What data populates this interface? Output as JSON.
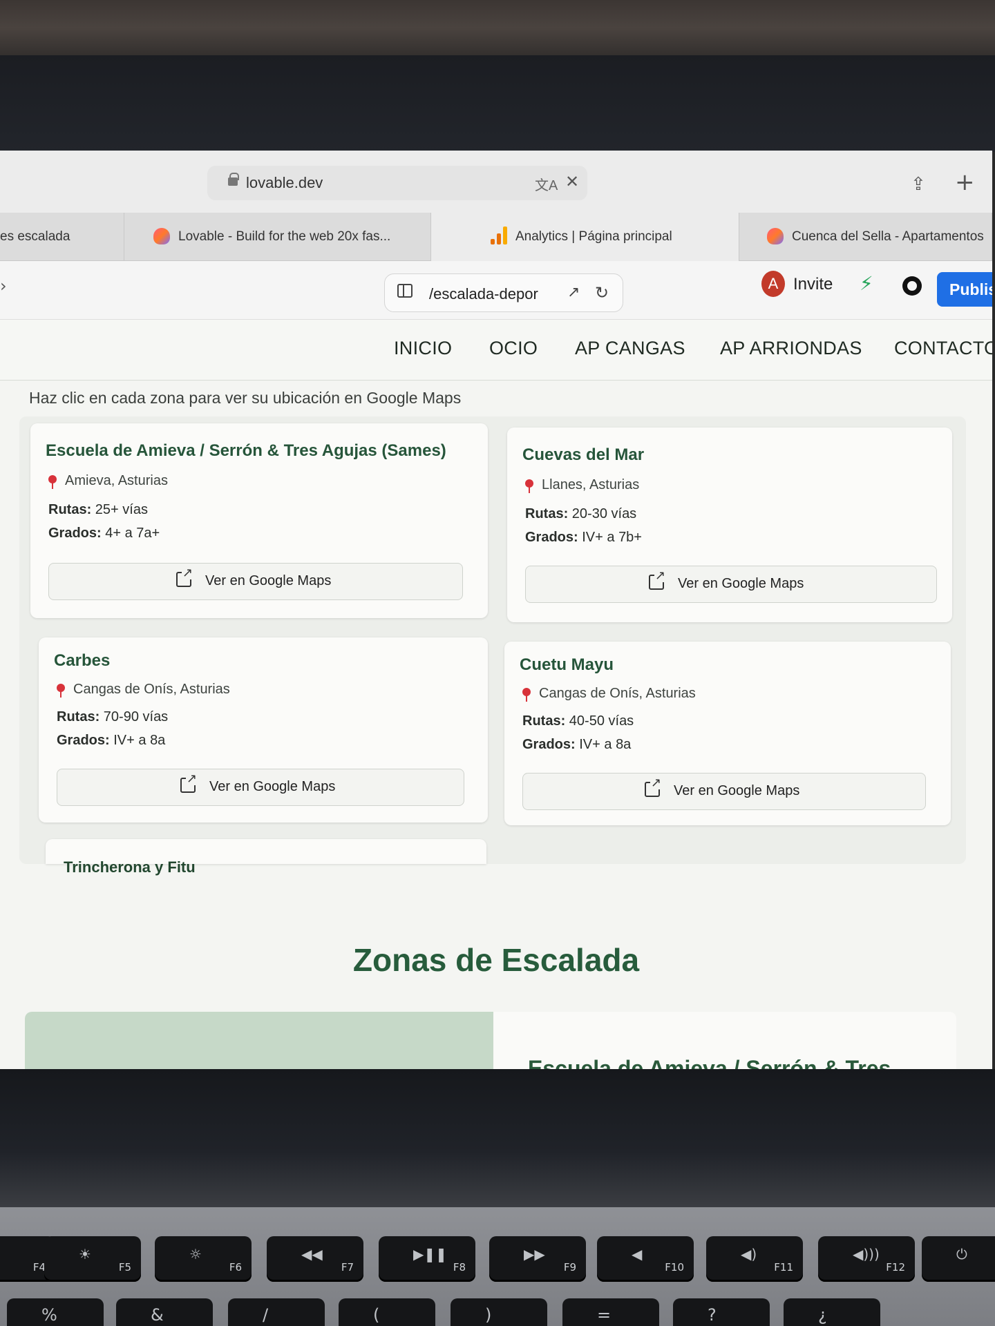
{
  "browser": {
    "url": "lovable.dev",
    "tabs": [
      {
        "label": "es escalada"
      },
      {
        "label": "Lovable - Build for the web 20x fas..."
      },
      {
        "label": "Analytics | Página principal"
      },
      {
        "label": "Cuenca del Sella - Apartamentos"
      }
    ]
  },
  "lovable": {
    "route": "/escalada-depor",
    "avatar_letter": "A",
    "invite_label": "Invite",
    "publish_label": "Publis"
  },
  "site": {
    "nav": [
      "INICIO",
      "OCIO",
      "AP CANGAS",
      "AP ARRIONDAS",
      "CONTACTO"
    ],
    "hint": "Haz clic en cada zona para ver su ubicación en Google Maps",
    "labels": {
      "routes": "Rutas:",
      "grades": "Grados:",
      "maps_button": "Ver en Google Maps"
    },
    "zones": [
      {
        "name": "Escuela de Amieva / Serrón & Tres Agujas (Sames)",
        "location": "Amieva, Asturias",
        "routes": "25+ vías",
        "grades": "4+ a 7a+"
      },
      {
        "name": "Cuevas del Mar",
        "location": "Llanes, Asturias",
        "routes": "20-30 vías",
        "grades": "IV+ a 7b+"
      },
      {
        "name": "Carbes",
        "location": "Cangas de Onís, Asturias",
        "routes": "70-90 vías",
        "grades": "IV+ a 8a"
      },
      {
        "name": "Cuetu Mayu",
        "location": "Cangas de Onís, Asturias",
        "routes": "40-50 vías",
        "grades": "IV+ a 8a"
      },
      {
        "name": "Trincherona y Fitu"
      }
    ],
    "section_title": "Zonas de Escalada",
    "bottom_card_title": "Escuela de Amieva / Serrón & Tres"
  },
  "keyboard": {
    "fkeys": [
      "F4",
      "F5",
      "F6",
      "F7",
      "F8",
      "F9",
      "F10",
      "F11",
      "F12"
    ],
    "row2": [
      "%",
      "&",
      "/",
      "(",
      ")",
      "=",
      "?",
      "¿"
    ]
  },
  "colors": {
    "accent_green": "#26553a",
    "publish_blue": "#1f6fe5",
    "bolt_green": "#27a55b"
  }
}
